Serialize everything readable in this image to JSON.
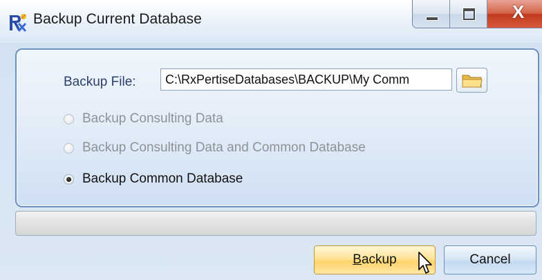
{
  "window": {
    "title": "Backup Current Database",
    "caption_buttons": [
      "minimize",
      "maximize",
      "close"
    ],
    "close_glyph": "X"
  },
  "backup_file": {
    "label": "Backup File:",
    "value": "C:\\RxPertiseDatabases\\BACKUP\\My Comm"
  },
  "options": [
    {
      "label": "Backup Consulting Data",
      "checked": false,
      "enabled": false
    },
    {
      "label": "Backup Consulting Data and Common Database",
      "checked": false,
      "enabled": false
    },
    {
      "label": "Backup Common Database",
      "checked": true,
      "enabled": true
    }
  ],
  "progress": {
    "value": 0
  },
  "buttons": {
    "backup_mnemonic": "B",
    "backup_rest": "ackup",
    "cancel": "Cancel"
  },
  "icons": {
    "app": "rx-app-icon",
    "browse": "folder-icon",
    "pointer": "mouse-pointer-icon"
  },
  "colors": {
    "accent": "#6c8fbf",
    "backup_button": "#ffd46a",
    "close_button": "#c0391f"
  }
}
